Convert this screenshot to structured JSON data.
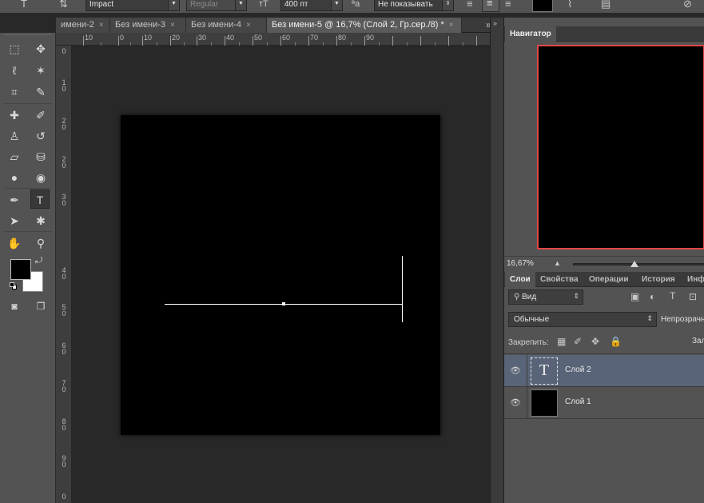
{
  "options_bar": {
    "font_family": "Impact",
    "font_style": "Regular",
    "font_size": "400 пт",
    "antialias": "Не показывать"
  },
  "tabs": [
    {
      "label": "имени-2"
    },
    {
      "label": "Без имени-3"
    },
    {
      "label": "Без имени-4"
    },
    {
      "label": "Без имени-5 @ 16,7% (Слой 2, Гр.сер./8) *",
      "active": true
    }
  ],
  "tab_overflow": "»",
  "ruler_top": [
    "10",
    "0",
    "10",
    "20",
    "30",
    "40",
    "50",
    "60",
    "70",
    "80",
    "90"
  ],
  "ruler_left": [
    {
      "chars": [
        "0"
      ]
    },
    {
      "chars": [
        "1",
        "0"
      ]
    },
    {
      "chars": [
        "2",
        "0"
      ]
    },
    {
      "chars": [
        "2",
        "0"
      ]
    },
    {
      "chars": [
        "3",
        "0"
      ]
    },
    {
      "chars": [
        "4",
        "0"
      ]
    },
    {
      "chars": [
        "5",
        "0"
      ]
    },
    {
      "chars": [
        "6",
        "0"
      ]
    },
    {
      "chars": [
        "7",
        "0"
      ]
    },
    {
      "chars": [
        "8",
        "0"
      ]
    },
    {
      "chars": [
        "9",
        "0"
      ]
    },
    {
      "chars": [
        "0"
      ]
    }
  ],
  "navigator": {
    "tab_label": "Навигатор",
    "zoom": "16,67%"
  },
  "layers_panel": {
    "tabs": [
      "Слои",
      "Свойства",
      "Операции",
      "История",
      "Инф"
    ],
    "filter_label": "Вид",
    "blend_mode": "Обычные",
    "opacity_label": "Непрозрачн",
    "lock_label": "Закрепить:",
    "fill_label": "Зал",
    "layers": [
      {
        "name": "Слой 2",
        "kind": "text",
        "selected": true
      },
      {
        "name": "Слой 1",
        "kind": "fill",
        "selected": false
      }
    ]
  },
  "colors": {
    "foreground": "#000000",
    "background": "#ffffff",
    "selected_layer_row": "#5a6478",
    "navigator_frame": "#e04646"
  },
  "icons": {
    "tools": [
      "rect-marquee-icon",
      "move-icon",
      "lasso-icon",
      "magic-wand-icon",
      "crop-icon",
      "eyedropper-icon",
      "healing-brush-icon",
      "brush-icon",
      "clone-stamp-icon",
      "history-brush-icon",
      "eraser-icon",
      "paint-bucket-icon",
      "blur-icon",
      "dodge-icon",
      "pen-icon",
      "type-tool-icon",
      "path-select-icon",
      "custom-shape-icon",
      "hand-icon",
      "zoom-icon"
    ]
  }
}
